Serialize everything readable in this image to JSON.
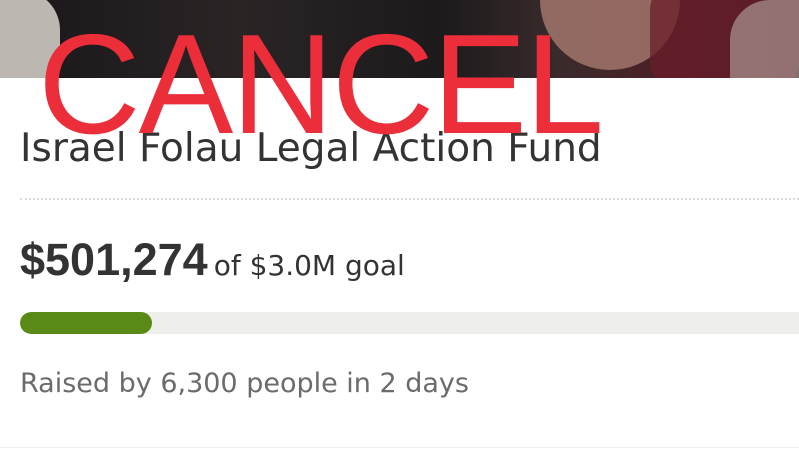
{
  "stamp": {
    "text": "CANCEL",
    "color": "#ec2d3a"
  },
  "campaign": {
    "title": "Israel Folau Legal Action Fund",
    "amount_raised": "$501,274",
    "goal_text": "of $3.0M goal",
    "progress_fraction": 0.167,
    "raised_by": "Raised by 6,300 people in 2 days"
  },
  "colors": {
    "progress_fill": "#5a8a16",
    "progress_track": "#eeeeea",
    "text_primary": "#333333",
    "text_secondary": "#6b6b6b"
  }
}
